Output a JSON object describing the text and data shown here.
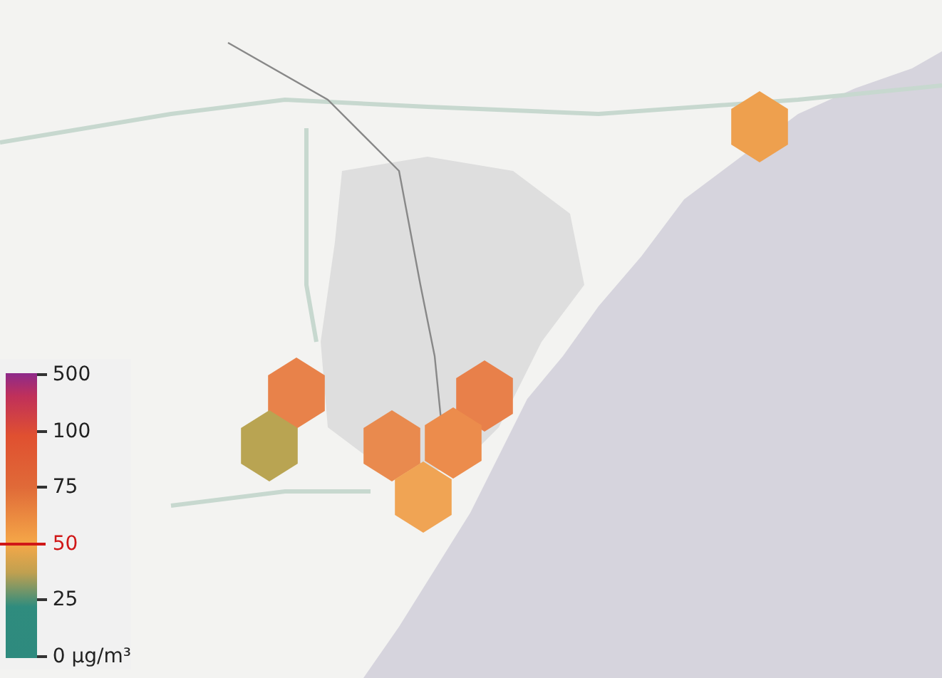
{
  "map": {
    "hexagons": [
      {
        "color": "#eea04e"
      },
      {
        "color": "#e8824a"
      },
      {
        "color": "#b9a452"
      },
      {
        "color": "#e8804a"
      },
      {
        "color": "#e98a4e"
      },
      {
        "color": "#ec8c4c"
      },
      {
        "color": "#f0a454"
      }
    ]
  },
  "legend": {
    "ticks": [
      {
        "label": "500",
        "highlighted": false
      },
      {
        "label": "100",
        "highlighted": false
      },
      {
        "label": "75",
        "highlighted": false
      },
      {
        "label": "50",
        "highlighted": true
      },
      {
        "label": "25",
        "highlighted": false
      },
      {
        "label": "0 μg/m³",
        "highlighted": false
      }
    ]
  }
}
